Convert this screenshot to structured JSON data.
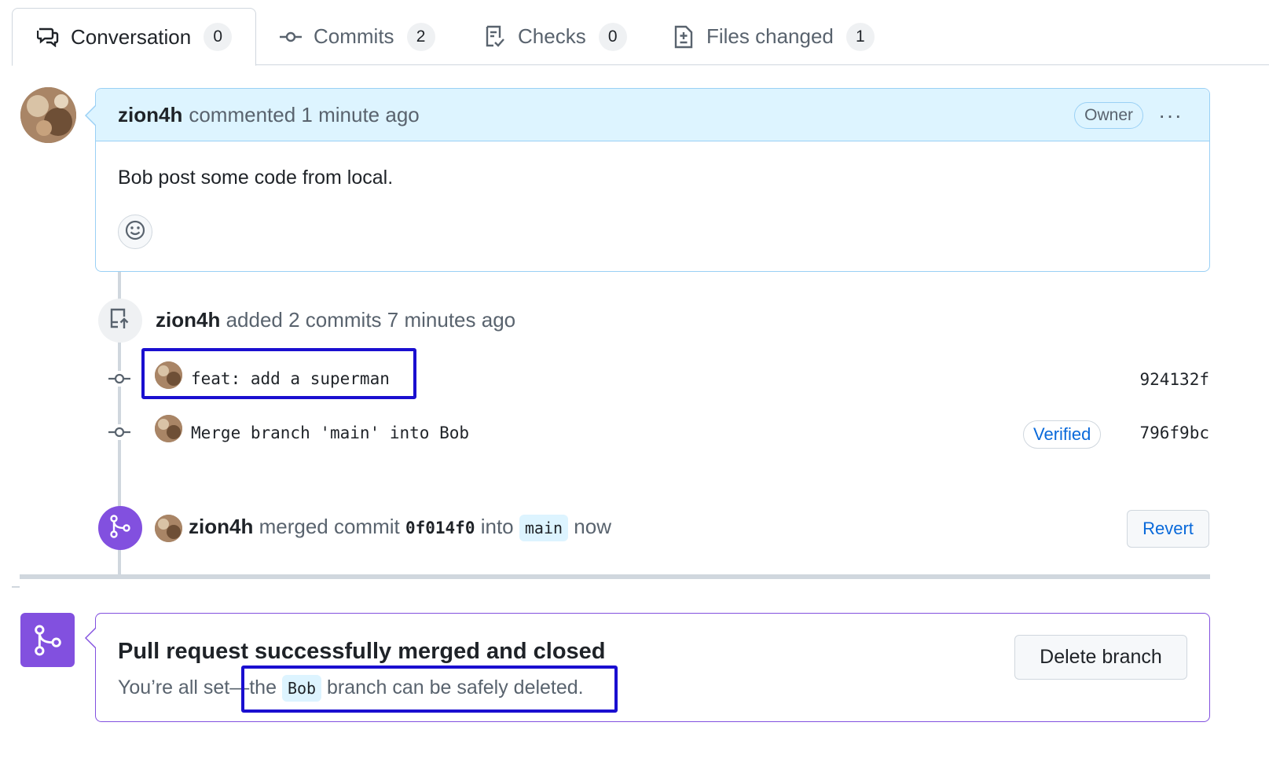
{
  "tabs": [
    {
      "label": "Conversation",
      "count": "0",
      "icon": "comment-discussion-icon"
    },
    {
      "label": "Commits",
      "count": "2",
      "icon": "git-commit-icon"
    },
    {
      "label": "Checks",
      "count": "0",
      "icon": "checklist-icon"
    },
    {
      "label": "Files changed",
      "count": "1",
      "icon": "file-diff-icon"
    }
  ],
  "comment": {
    "author": "zion4h",
    "action": "commented",
    "time": "1 minute ago",
    "role": "Owner",
    "menu": "···",
    "body": "Bob post some code from local."
  },
  "push_event": {
    "author": "zion4h",
    "text": "added 2 commits 7 minutes ago",
    "commits": [
      {
        "message": "feat: add a superman",
        "sha": "924132f"
      },
      {
        "message": "Merge branch 'main' into Bob",
        "sha": "796f9bc",
        "badge": "Verified"
      }
    ]
  },
  "merge_event": {
    "author": "zion4h",
    "action": "merged commit",
    "commit": "0f014f0",
    "into": "into",
    "branch": "main",
    "time": "now",
    "revert_label": "Revert"
  },
  "merged_box": {
    "title": "Pull request successfully merged and closed",
    "sub_prefix": "You’re all set—the",
    "branch": "Bob",
    "sub_suffix": "branch can be safely deleted.",
    "delete_label": "Delete branch"
  },
  "colors": {
    "accent": "#0969da",
    "merged": "#8250df",
    "highlight": "#1a0fd0"
  }
}
